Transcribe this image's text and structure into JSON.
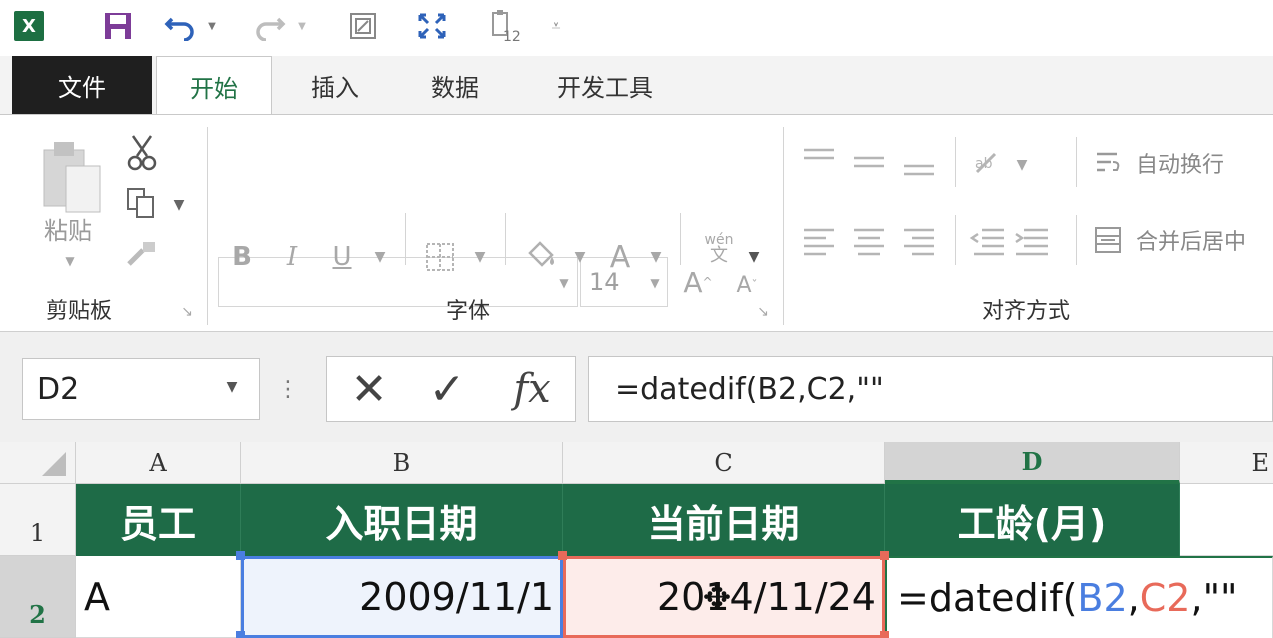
{
  "qat": {
    "logo_text": "X",
    "icons": [
      "excel-logo-icon",
      "save-icon",
      "undo-icon",
      "redo-icon",
      "touch-mode-icon",
      "fullscreen-icon",
      "form-icon",
      "customize-icon"
    ]
  },
  "tabs": {
    "file": "文件",
    "home": "开始",
    "insert": "插入",
    "data": "数据",
    "developer": "开发工具"
  },
  "ribbon": {
    "paste_label": "粘贴",
    "clipboard_label": "剪贴板",
    "font_group_label": "字体",
    "align_group_label": "对齐方式",
    "font_size": "14",
    "bold": "B",
    "italic": "I",
    "underline": "U",
    "font_color": "A",
    "grow_font": "A",
    "shrink_font": "A",
    "phonetic": "wén",
    "phonetic_sub": "文",
    "wrap_text": "自动换行",
    "merge_center": "合并后居中"
  },
  "formula_bar": {
    "name_box": "D2",
    "fx": "fx",
    "formula": "=datedif(B2,C2,\"\""
  },
  "grid": {
    "columns": [
      "A",
      "B",
      "C",
      "D",
      "E"
    ],
    "rows": [
      "1",
      "2"
    ],
    "headers": [
      "员工",
      "入职日期",
      "当前日期",
      "工龄(月)"
    ],
    "row2": {
      "a": "A",
      "b": "2009/11/1",
      "c": "2014/11/24",
      "d_prefix": "=datedif(",
      "d_ref_b": "B2",
      "d_sep1": ",",
      "d_ref_c": "C2",
      "d_suffix": ",\"\""
    }
  },
  "colors": {
    "excel_green": "#217346",
    "header_fill": "#1e6b47",
    "ref_blue": "#4a7ee0",
    "ref_red": "#e86a5a"
  }
}
